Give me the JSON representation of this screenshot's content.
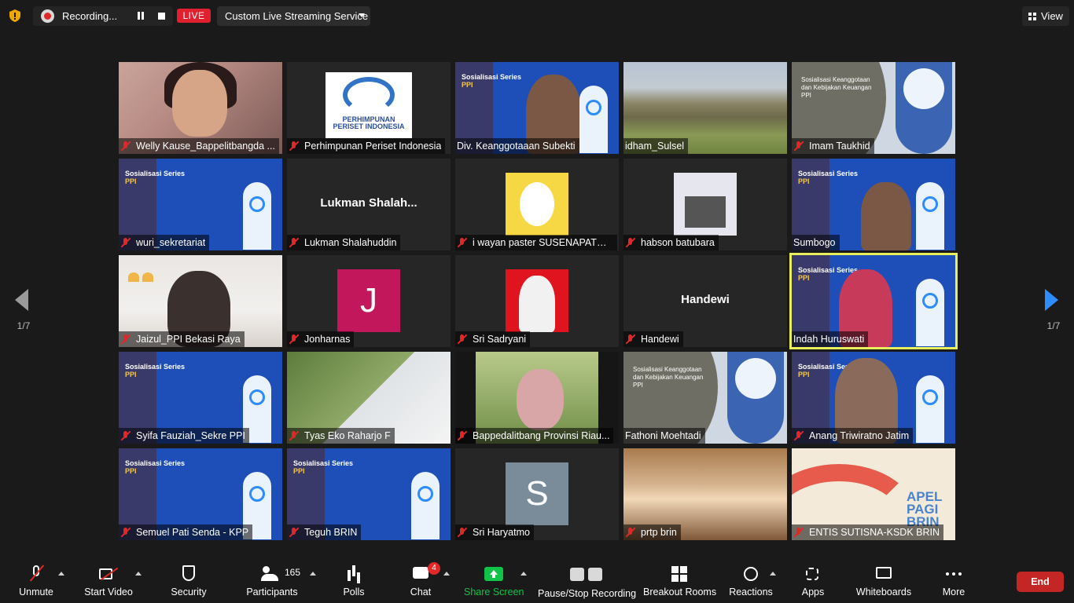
{
  "topbar": {
    "recording_label": "Recording...",
    "live_label": "LIVE",
    "stream_service": "Custom Live Streaming Service",
    "view_label": "View"
  },
  "pager": {
    "prev_label": "1/7",
    "next_label": "1/7"
  },
  "tiles": [
    {
      "name": "Welly Kause_Bappelitbangda ..."
    },
    {
      "name": "Perhimpunan Periset Indonesia",
      "logo_text": "PERHIMPUNAN PERISET INDONESIA"
    },
    {
      "name": "Div. Keanggotaaan Subekti"
    },
    {
      "name": "idham_Sulsel"
    },
    {
      "name": "Imam Taukhid"
    },
    {
      "name": "wuri_sekretariat"
    },
    {
      "name": "Lukman Shalahuddin",
      "display": "Lukman  Shalah..."
    },
    {
      "name": "i wayan paster SUSENAPATHY..."
    },
    {
      "name": "habson batubara"
    },
    {
      "name": "Sumbogo"
    },
    {
      "name": "Jaizul_PPI Bekasi Raya"
    },
    {
      "name": "Jonharnas",
      "initial": "J"
    },
    {
      "name": "Sri Sadryani"
    },
    {
      "name": "Handewi",
      "display": "Handewi"
    },
    {
      "name": "Indah Huruswati"
    },
    {
      "name": "Syifa Fauziah_Sekre PPI"
    },
    {
      "name": "Tyas Eko Raharjo F"
    },
    {
      "name": "Bappedalitbang Provinsi Riau..."
    },
    {
      "name": "Fathoni Moehtadi"
    },
    {
      "name": "Anang Triwiratno Jatim"
    },
    {
      "name": "Semuel Pati Senda - KPP"
    },
    {
      "name": "Teguh BRIN"
    },
    {
      "name": "Sri Haryatmo",
      "initial": "S"
    },
    {
      "name": "prtp brin"
    },
    {
      "name": "ENTIS SUTISNA-KSDK BRIN",
      "apel_text": "APEL PAGI BRIN"
    }
  ],
  "slide": {
    "series_title": "Sosialisasi Series",
    "series_sub": "PPI",
    "grey_text": "Sosialisasi Keanggotaan dan Kebijakan Keuangan PPI"
  },
  "toolbar": {
    "unmute": "Unmute",
    "start_video": "Start Video",
    "security": "Security",
    "participants": "Participants",
    "participants_count": "165",
    "polls": "Polls",
    "chat": "Chat",
    "chat_badge": "4",
    "share_screen": "Share Screen",
    "pause_stop_recording": "Pause/Stop Recording",
    "breakout_rooms": "Breakout Rooms",
    "reactions": "Reactions",
    "apps": "Apps",
    "whiteboards": "Whiteboards",
    "more": "More",
    "end": "End"
  },
  "colors": {
    "accent": "#2d8cff",
    "live": "#e0202e",
    "share": "#12c34a",
    "end": "#c42525",
    "active_speaker": "#e7f05a"
  }
}
